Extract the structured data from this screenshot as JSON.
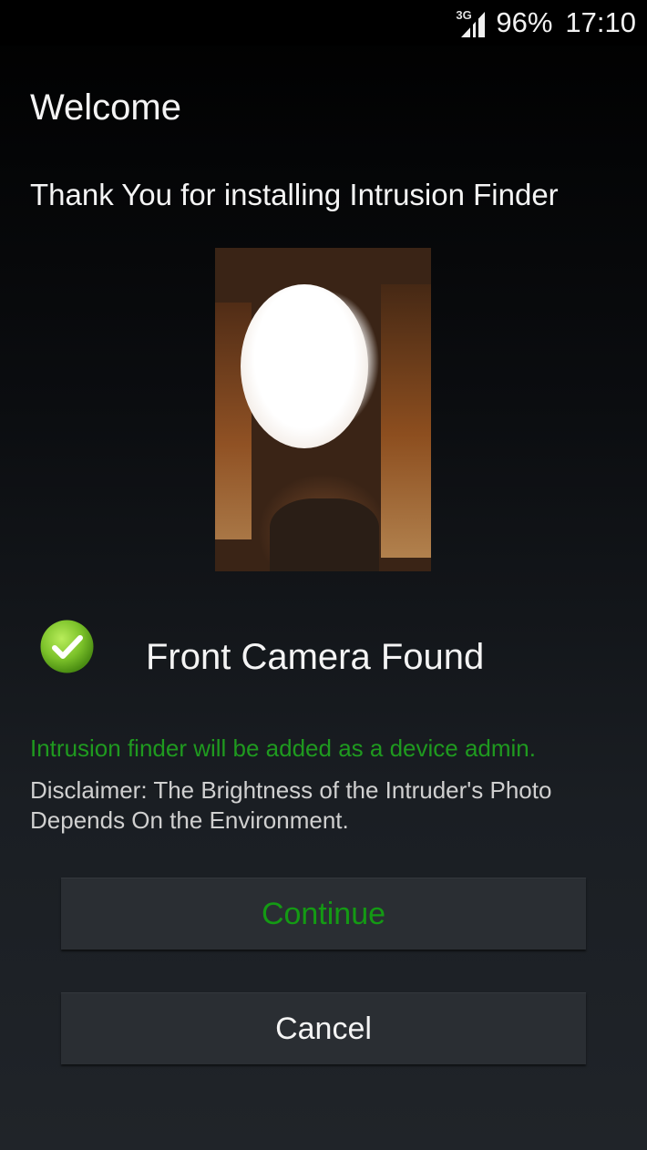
{
  "status_bar": {
    "network": "3G",
    "battery": "96%",
    "time": "17:10"
  },
  "welcome": {
    "title": "Welcome",
    "subtitle": "Thank You for installing Intrusion Finder"
  },
  "camera": {
    "status": "Front Camera Found",
    "icon": "check-circle-icon"
  },
  "notes": {
    "admin": "Intrusion finder will be added as a device admin.",
    "disclaimer": "Disclaimer: The Brightness of the Intruder's Photo Depends On the Environment."
  },
  "buttons": {
    "continue_label": "Continue",
    "cancel_label": "Cancel"
  },
  "colors": {
    "accent_green": "#149a14",
    "check_green": "#7cc22a",
    "button_bg": "#2a2e33"
  }
}
